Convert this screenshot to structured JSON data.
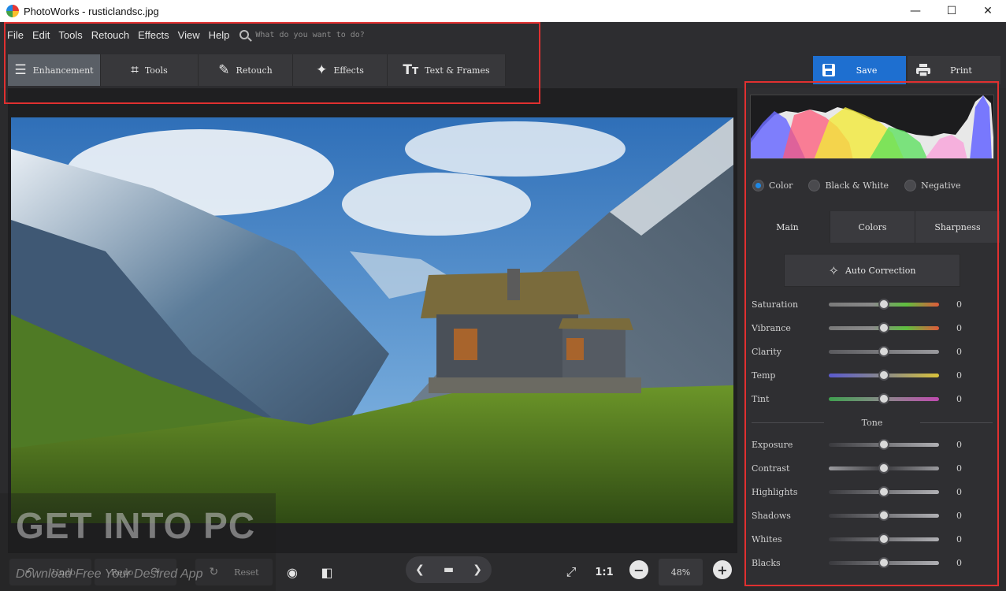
{
  "window": {
    "title": "PhotoWorks - rusticlandsc.jpg",
    "controls": [
      "—",
      "☐",
      "✕"
    ]
  },
  "menu": {
    "items": [
      "File",
      "Edit",
      "Tools",
      "Retouch",
      "Effects",
      "View",
      "Help"
    ],
    "search_placeholder": "What do you want to do?"
  },
  "tabs": [
    {
      "label": "Enhancement",
      "icon": "sliders-icon",
      "active": true
    },
    {
      "label": "Tools",
      "icon": "crop-icon",
      "active": false
    },
    {
      "label": "Retouch",
      "icon": "brush-icon",
      "active": false
    },
    {
      "label": "Effects",
      "icon": "magic-wand-icon",
      "active": false
    },
    {
      "label": "Text & Frames",
      "icon": "text-icon",
      "active": false
    }
  ],
  "actions": {
    "save": "Save",
    "print": "Print"
  },
  "bottom": {
    "undo": "Undo",
    "redo": "Redo",
    "reset": "Reset",
    "zoom_ratio": "1:1",
    "zoom_level": "48%"
  },
  "panel": {
    "modes": [
      {
        "label": "Color",
        "selected": true
      },
      {
        "label": "Black & White",
        "selected": false
      },
      {
        "label": "Negative",
        "selected": false
      }
    ],
    "subtabs": [
      {
        "label": "Main",
        "active": true
      },
      {
        "label": "Colors",
        "active": false
      },
      {
        "label": "Sharpness",
        "active": false
      }
    ],
    "auto_correction": "Auto Correction",
    "sliders": [
      {
        "label": "Saturation",
        "value": "0",
        "level": 0.5
      },
      {
        "label": "Vibrance",
        "value": "0",
        "level": 0.5
      },
      {
        "label": "Clarity",
        "value": "0",
        "level": 0.5
      },
      {
        "label": "Temp",
        "value": "0",
        "level": 0.5
      },
      {
        "label": "Tint",
        "value": "0",
        "level": 0.5
      }
    ],
    "tone_label": "Tone",
    "tone_sliders": [
      {
        "label": "Exposure",
        "value": "0",
        "level": 0.5
      },
      {
        "label": "Contrast",
        "value": "0",
        "level": 0.5
      },
      {
        "label": "Highlights",
        "value": "0",
        "level": 0.5
      },
      {
        "label": "Shadows",
        "value": "0",
        "level": 0.5
      },
      {
        "label": "Whites",
        "value": "0",
        "level": 0.5
      },
      {
        "label": "Blacks",
        "value": "0",
        "level": 0.5
      }
    ]
  },
  "watermark": {
    "title": "GET INTO PC",
    "subtitle": "Download Free Your Desired App"
  },
  "colors": {
    "accent": "#1e6fd0",
    "highlight": "#e03030",
    "radio_on": "#1e88e5"
  }
}
